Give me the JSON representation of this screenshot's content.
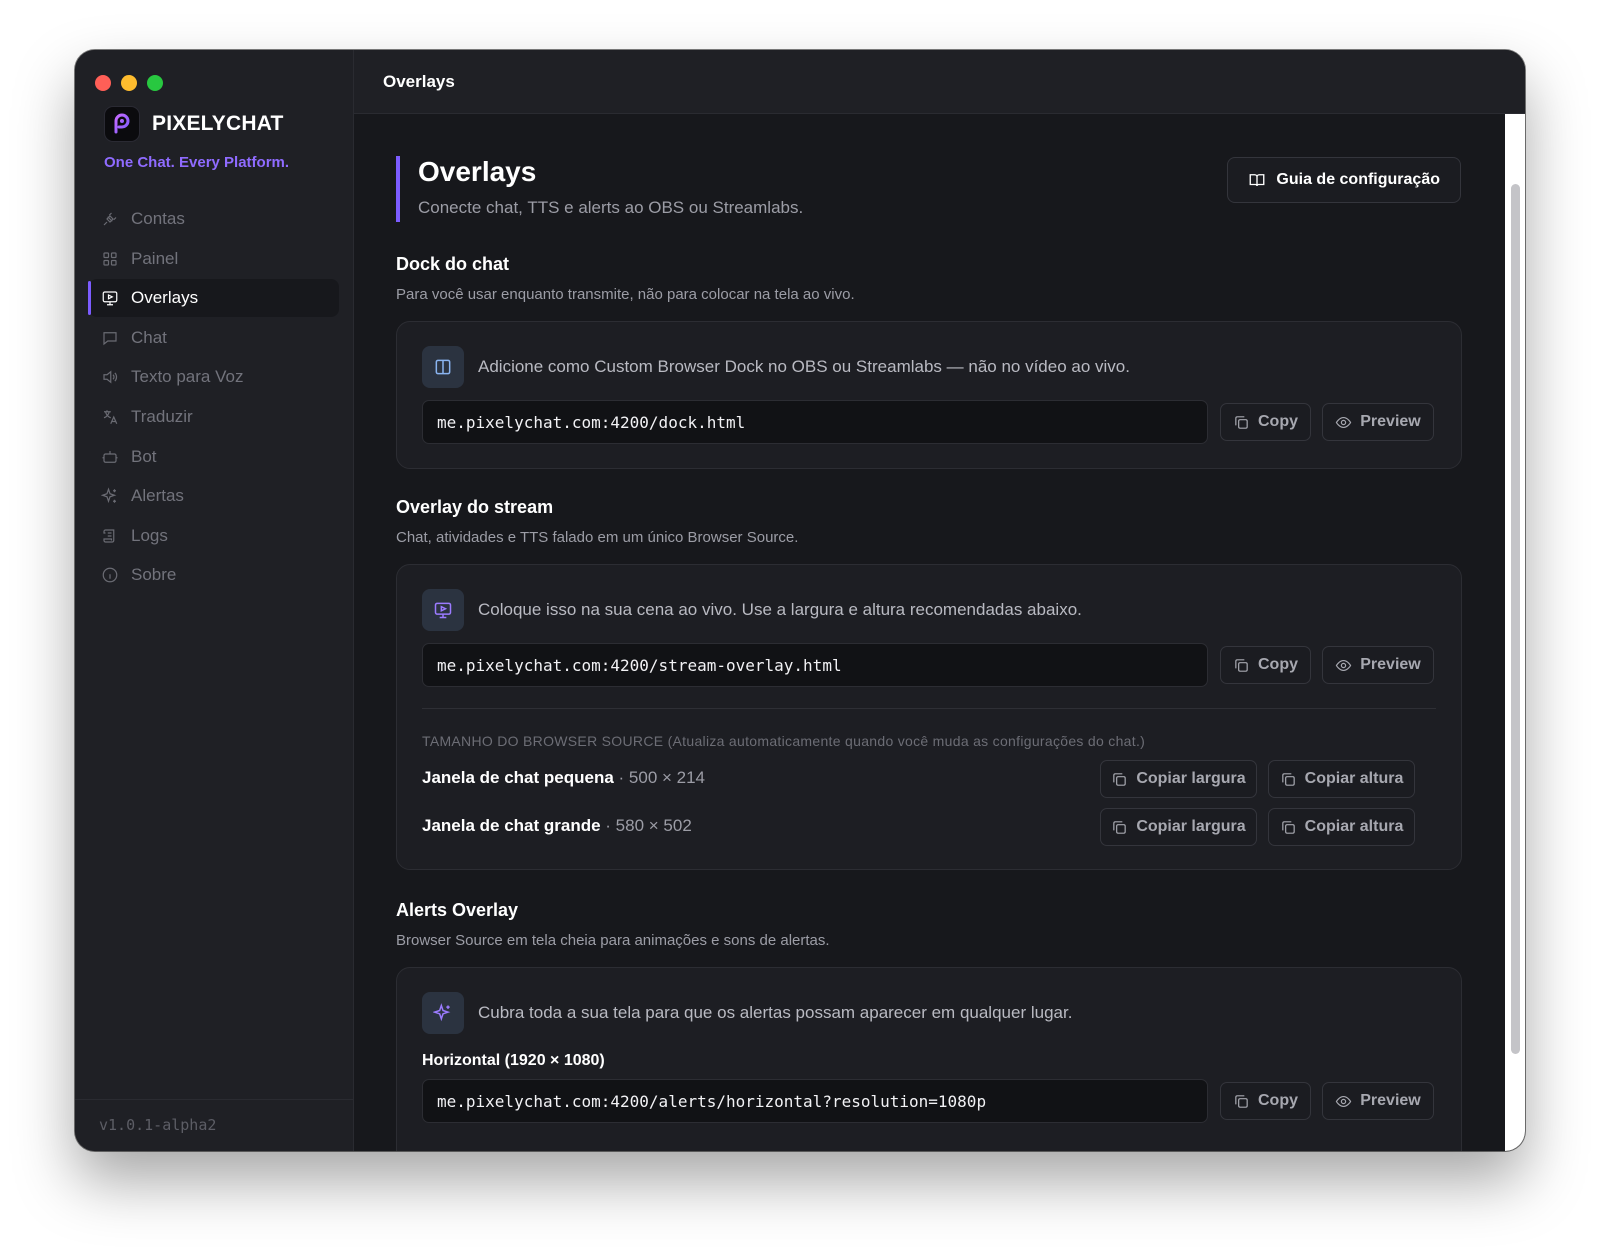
{
  "app": {
    "brand_name": "PIXELYCHAT",
    "tagline": "One Chat. Every Platform.",
    "version": "v1.0.1-alpha2",
    "accent_color": "#7c5cff"
  },
  "sidebar": {
    "items": [
      {
        "label": "Contas",
        "icon": "plug-icon",
        "active": false
      },
      {
        "label": "Painel",
        "icon": "grid-icon",
        "active": false
      },
      {
        "label": "Overlays",
        "icon": "monitor-play-icon",
        "active": true
      },
      {
        "label": "Chat",
        "icon": "chat-bubble-icon",
        "active": false
      },
      {
        "label": "Texto para Voz",
        "icon": "speaker-icon",
        "active": false
      },
      {
        "label": "Traduzir",
        "icon": "translate-icon",
        "active": false
      },
      {
        "label": "Bot",
        "icon": "bot-icon",
        "active": false
      },
      {
        "label": "Alertas",
        "icon": "sparkles-icon",
        "active": false
      },
      {
        "label": "Logs",
        "icon": "scroll-icon",
        "active": false
      },
      {
        "label": "Sobre",
        "icon": "info-icon",
        "active": false
      }
    ]
  },
  "topbar": {
    "title": "Overlays"
  },
  "page": {
    "title": "Overlays",
    "subtitle": "Conecte chat, TTS e alerts ao OBS ou Streamlabs.",
    "guide_button": "Guia de configuração"
  },
  "dock": {
    "title": "Dock do chat",
    "desc": "Para você usar enquanto transmite, não para colocar na tela ao vivo.",
    "hint": "Adicione como Custom Browser Dock no OBS ou Streamlabs — não no vídeo ao vivo.",
    "url": "me.pixelychat.com:4200/dock.html",
    "copy": "Copy",
    "preview": "Preview"
  },
  "stream": {
    "title": "Overlay do stream",
    "desc": "Chat, atividades e TTS falado em um único Browser Source.",
    "hint": "Coloque isso na sua cena ao vivo. Use a largura e altura recomendadas abaixo.",
    "url": "me.pixelychat.com:4200/stream-overlay.html",
    "copy": "Copy",
    "preview": "Preview",
    "size_caption": "TAMANHO DO BROWSER SOURCE",
    "size_note": "(Atualiza automaticamente quando você muda as configurações do chat.)",
    "sizes": [
      {
        "name": "Janela de chat pequena",
        "dims": " · 500 × 214",
        "copy_width": "Copiar largura",
        "copy_height": "Copiar altura"
      },
      {
        "name": "Janela de chat grande",
        "dims": " · 580 × 502",
        "copy_width": "Copiar largura",
        "copy_height": "Copiar altura"
      }
    ]
  },
  "alerts": {
    "title": "Alerts Overlay",
    "desc": "Browser Source em tela cheia para animações e sons de alertas.",
    "hint": "Cubra toda a sua tela para que os alertas possam aparecer em qualquer lugar.",
    "resolution_label": "Horizontal (1920 × 1080)",
    "url": "me.pixelychat.com:4200/alerts/horizontal?resolution=1080p",
    "copy": "Copy",
    "preview": "Preview"
  }
}
